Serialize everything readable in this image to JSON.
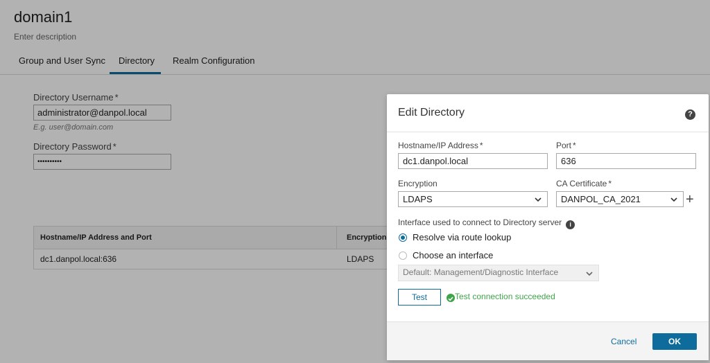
{
  "page": {
    "title": "domain1",
    "description": "Enter description",
    "tabs": [
      {
        "label": "Group and User Sync"
      },
      {
        "label": "Directory"
      },
      {
        "label": "Realm Configuration"
      }
    ]
  },
  "form": {
    "username_label": "Directory Username",
    "username_value": "administrator@danpol.local",
    "username_hint": "E.g. user@domain.com",
    "password_label": "Directory Password",
    "password_value": "••••••••••",
    "required_mark": "*"
  },
  "table": {
    "headers": [
      "Hostname/IP Address and Port",
      "Encryption"
    ],
    "rows": [
      {
        "host_port": "dc1.danpol.local:636",
        "encryption": "LDAPS"
      }
    ]
  },
  "modal": {
    "title": "Edit Directory",
    "help_icon_glyph": "?",
    "hostname_label": "Hostname/IP Address",
    "hostname_value": "dc1.danpol.local",
    "port_label": "Port",
    "port_value": "636",
    "encryption_label": "Encryption",
    "encryption_value": "LDAPS",
    "ca_label": "CA Certificate",
    "ca_value": "DANPOL_CA_2021",
    "add_glyph": "+",
    "interface_label": "Interface used to connect to Directory server",
    "info_glyph": "i",
    "radio_options": [
      {
        "label": "Resolve via route lookup",
        "checked": true
      },
      {
        "label": "Choose an interface",
        "checked": false
      }
    ],
    "interface_select_value": "Default: Management/Diagnostic Interface",
    "test_label": "Test",
    "test_result": "Test connection succeeded",
    "cancel_label": "Cancel",
    "ok_label": "OK"
  },
  "colors": {
    "accent": "#0d6c9b",
    "success": "#3fa44a"
  }
}
